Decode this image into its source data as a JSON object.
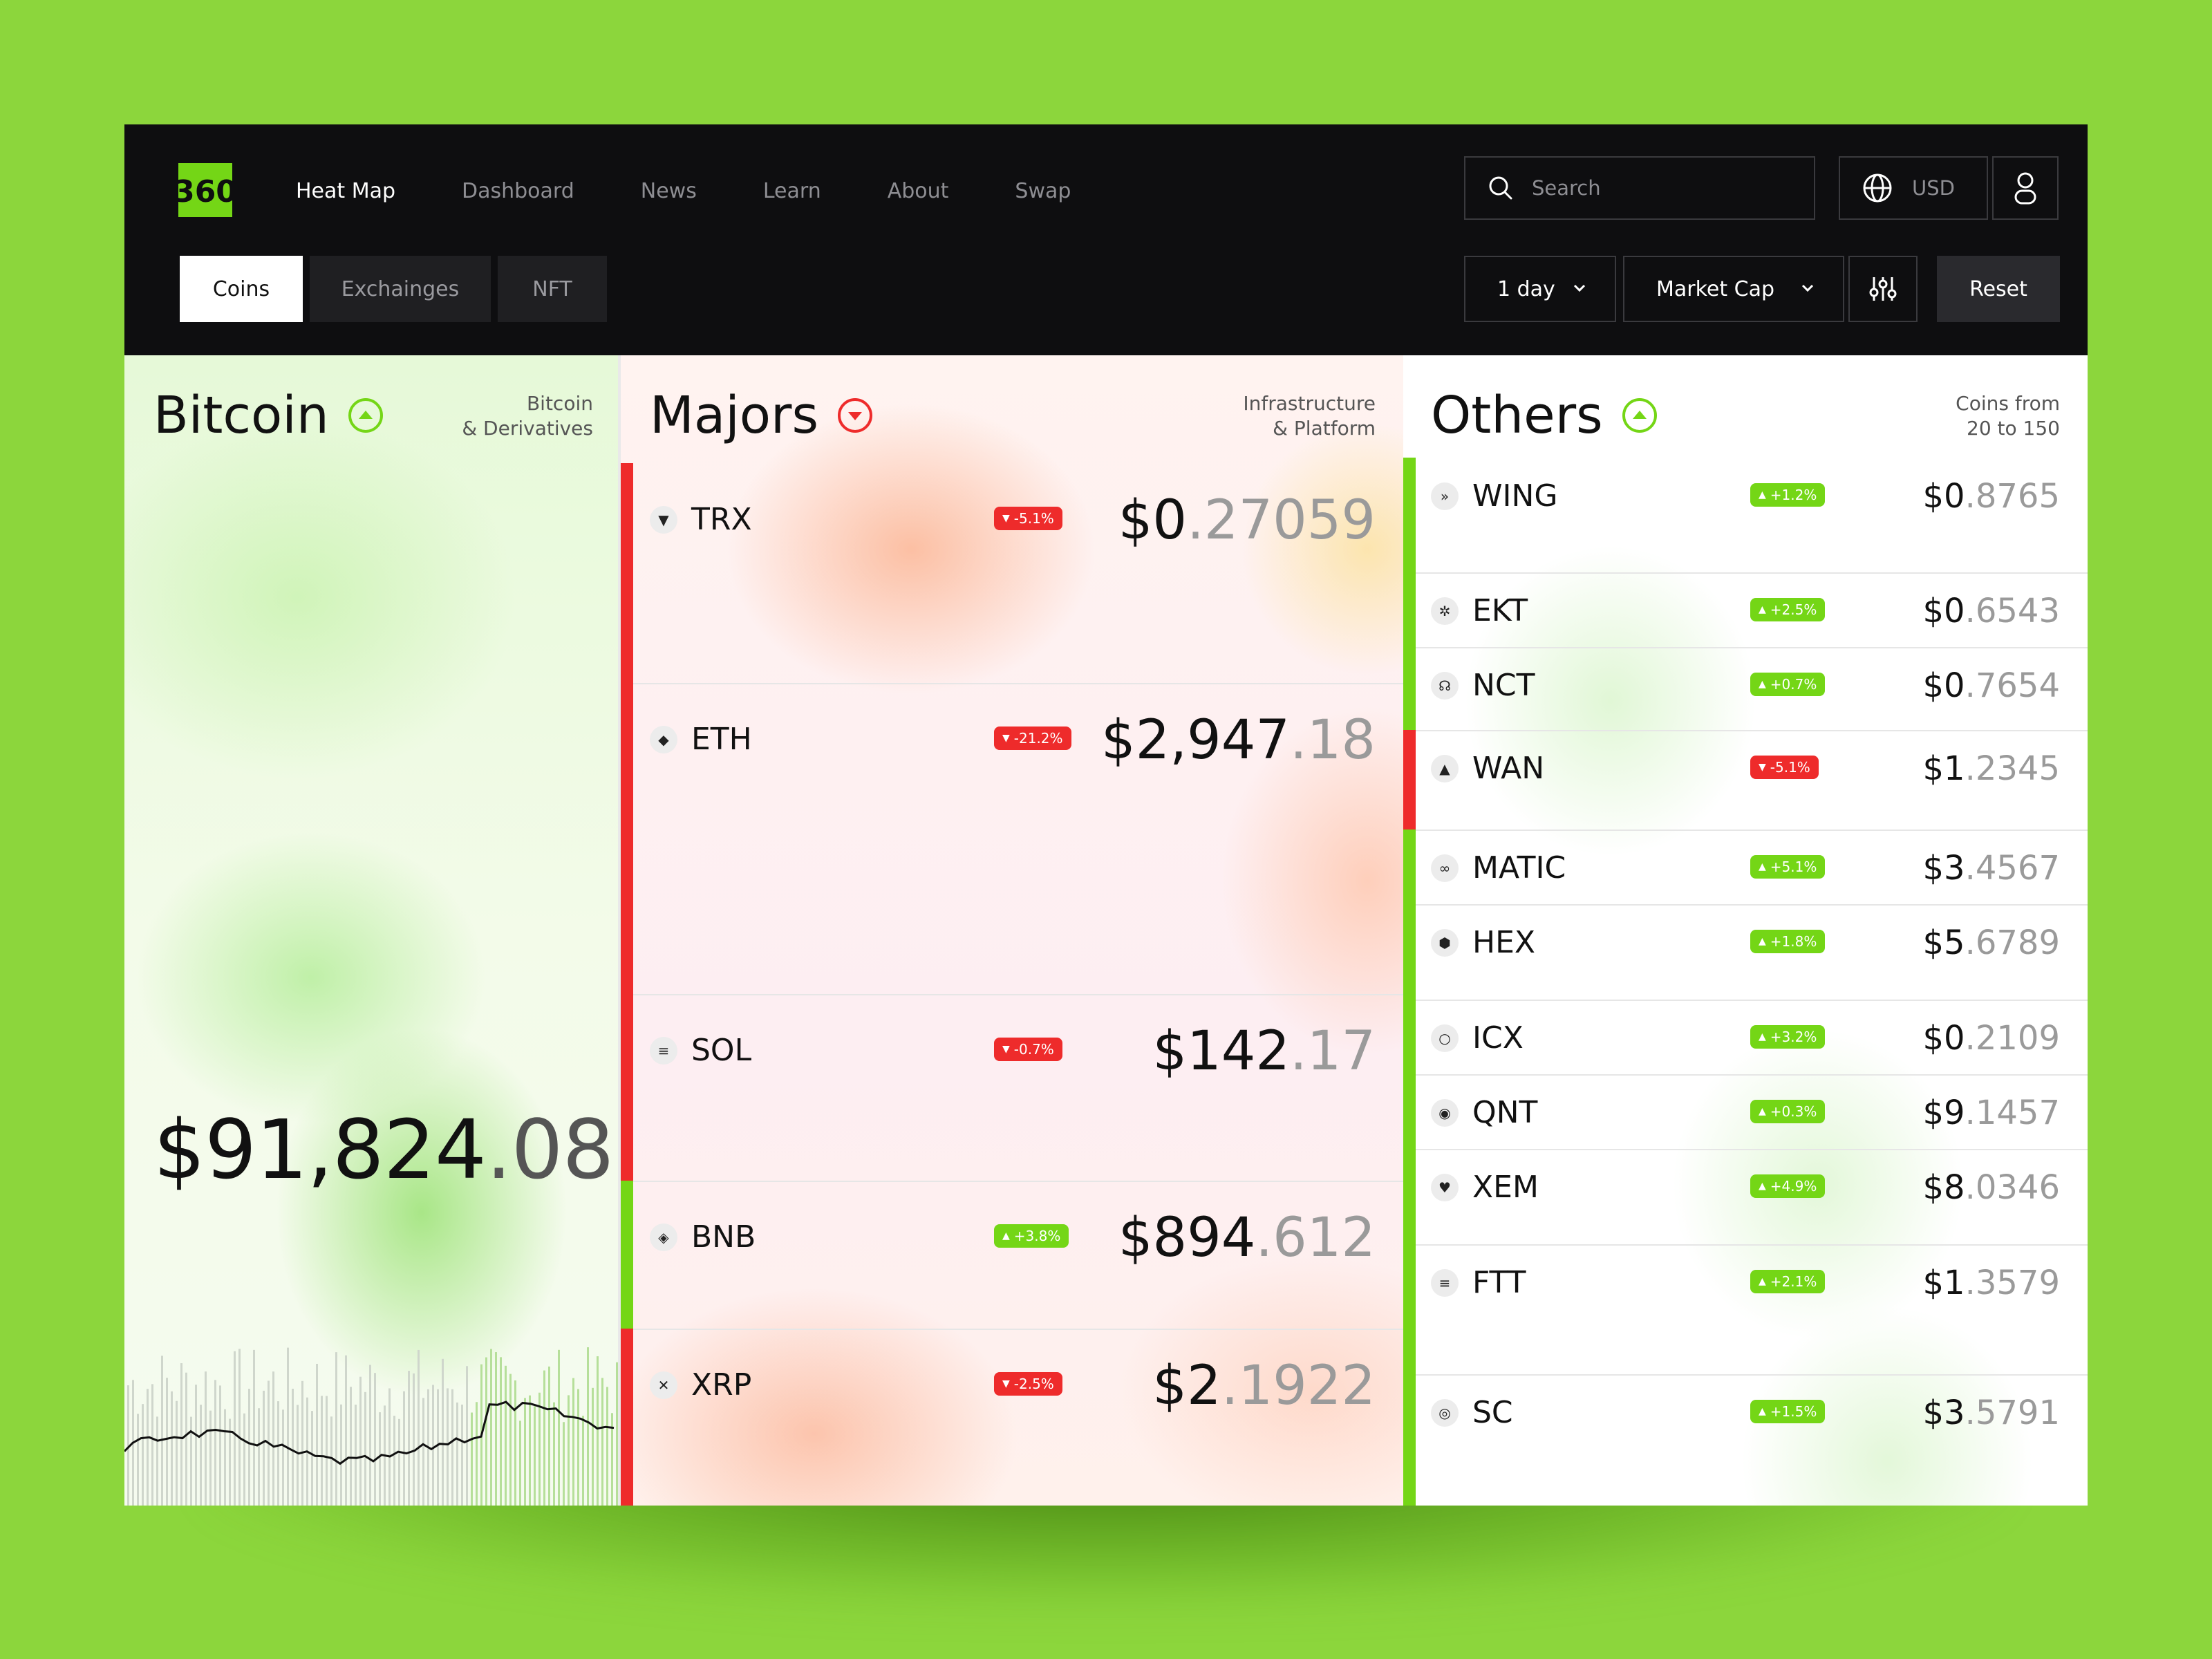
{
  "brand": {
    "logo_text": "360",
    "accent": "#74d616",
    "negative": "#ee2b2b"
  },
  "nav": {
    "items": [
      {
        "label": "Heat Map",
        "active": true
      },
      {
        "label": "Dashboard"
      },
      {
        "label": "News"
      },
      {
        "label": "Learn"
      },
      {
        "label": "About"
      },
      {
        "label": "Swap"
      }
    ]
  },
  "search": {
    "placeholder": "Search",
    "icon": "search-icon"
  },
  "currency": {
    "label": "USD",
    "icon": "globe-icon"
  },
  "account": {
    "icon": "user-icon"
  },
  "tabs": [
    {
      "label": "Coins",
      "active": true
    },
    {
      "label": "Exchainges"
    },
    {
      "label": "NFT"
    }
  ],
  "filters": {
    "period": "1 day",
    "metric": "Market Cap",
    "settings_icon": "sliders-icon",
    "reset_label": "Reset"
  },
  "bitcoin": {
    "title": "Bitcoin",
    "subtitle": "Bitcoin\n& Derivatives",
    "trend": "up",
    "price_int": "$91,824",
    "price_dec": ".08"
  },
  "majors": {
    "title": "Majors",
    "subtitle": "Infrastructure\n& Platform",
    "trend": "down",
    "coins": [
      {
        "symbol": "TRX",
        "icon": "trx-icon",
        "glyph": "▼",
        "change": "-5.1%",
        "dir": "down",
        "price_int": "$0",
        "price_dec": ".27059"
      },
      {
        "symbol": "ETH",
        "icon": "eth-icon",
        "glyph": "◆",
        "change": "-21.2%",
        "dir": "down",
        "price_int": "$2,947",
        "price_dec": ".18"
      },
      {
        "symbol": "SOL",
        "icon": "sol-icon",
        "glyph": "≡",
        "change": "-0.7%",
        "dir": "down",
        "price_int": "$142",
        "price_dec": ".17"
      },
      {
        "symbol": "BNB",
        "icon": "bnb-icon",
        "glyph": "◈",
        "change": "+3.8%",
        "dir": "up",
        "price_int": "$894",
        "price_dec": ".612"
      },
      {
        "symbol": "XRP",
        "icon": "xrp-icon",
        "glyph": "✕",
        "change": "-2.5%",
        "dir": "down",
        "price_int": "$2",
        "price_dec": ".1922"
      }
    ]
  },
  "others": {
    "title": "Others",
    "subtitle": "Coins from\n20 to 150",
    "trend": "up",
    "coins": [
      {
        "symbol": "WING",
        "icon": "wing-icon",
        "glyph": "»",
        "change": "+1.2%",
        "dir": "up",
        "price_int": "$0",
        "price_dec": ".8765"
      },
      {
        "symbol": "EKT",
        "icon": "ekt-icon",
        "glyph": "✲",
        "change": "+2.5%",
        "dir": "up",
        "price_int": "$0",
        "price_dec": ".6543"
      },
      {
        "symbol": "NCT",
        "icon": "nct-icon",
        "glyph": "☊",
        "change": "+0.7%",
        "dir": "up",
        "price_int": "$0",
        "price_dec": ".7654"
      },
      {
        "symbol": "WAN",
        "icon": "wan-icon",
        "glyph": "▲",
        "change": "-5.1%",
        "dir": "down",
        "price_int": "$1",
        "price_dec": ".2345"
      },
      {
        "symbol": "MATIC",
        "icon": "matic-icon",
        "glyph": "∞",
        "change": "+5.1%",
        "dir": "up",
        "price_int": "$3",
        "price_dec": ".4567"
      },
      {
        "symbol": "HEX",
        "icon": "hex-icon",
        "glyph": "⬢",
        "change": "+1.8%",
        "dir": "up",
        "price_int": "$5",
        "price_dec": ".6789"
      },
      {
        "symbol": "ICX",
        "icon": "icx-icon",
        "glyph": "○",
        "change": "+3.2%",
        "dir": "up",
        "price_int": "$0",
        "price_dec": ".2109"
      },
      {
        "symbol": "QNT",
        "icon": "qnt-icon",
        "glyph": "◉",
        "change": "+0.3%",
        "dir": "up",
        "price_int": "$9",
        "price_dec": ".1457"
      },
      {
        "symbol": "XEM",
        "icon": "xem-icon",
        "glyph": "♥",
        "change": "+4.9%",
        "dir": "up",
        "price_int": "$8",
        "price_dec": ".0346"
      },
      {
        "symbol": "FTT",
        "icon": "ftt-icon",
        "glyph": "≡",
        "change": "+2.1%",
        "dir": "up",
        "price_int": "$1",
        "price_dec": ".3579"
      },
      {
        "symbol": "SC",
        "icon": "sc-icon",
        "glyph": "◎",
        "change": "+1.5%",
        "dir": "up",
        "price_int": "$3",
        "price_dec": ".5791"
      }
    ]
  }
}
